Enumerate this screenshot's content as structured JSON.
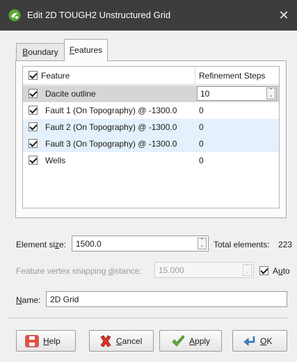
{
  "window": {
    "title": "Edit 2D TOUGH2 Unstructured Grid",
    "close_glyph": "✕"
  },
  "tabs": [
    {
      "label": "Boundary",
      "mnemonic": "B",
      "rest": "oundary"
    },
    {
      "label": "Features",
      "mnemonic": "F",
      "rest": "eatures",
      "active": true
    }
  ],
  "table": {
    "columns": [
      "Feature",
      "Refinement Steps"
    ],
    "rows": [
      {
        "name": "Dacite outline",
        "steps": "10",
        "checked": true,
        "selected": true
      },
      {
        "name": "Fault 1 (On Topography) @ -1300.0",
        "steps": "0",
        "checked": true
      },
      {
        "name": "Fault 2 (On Topography) @ -1300.0",
        "steps": "0",
        "checked": true
      },
      {
        "name": "Fault 3 (On Topography) @ -1300.0",
        "steps": "0",
        "checked": true
      },
      {
        "name": "Wells",
        "steps": "0",
        "checked": true
      }
    ]
  },
  "element_size": {
    "label_pre": "Element si",
    "label_mn": "z",
    "label_post": "e:",
    "value": "1500.0"
  },
  "total_elements": {
    "label": "Total elements:",
    "value": "223"
  },
  "snapping": {
    "label_pre": "Feature vertex snapping ",
    "label_mn": "d",
    "label_post": "istance:",
    "value": "15.000",
    "auto_pre": "A",
    "auto_mn": "u",
    "auto_post": "to",
    "auto_checked": true
  },
  "name": {
    "label_mn": "N",
    "label_post": "ame:",
    "value": "2D Grid"
  },
  "buttons": {
    "help": {
      "mn": "H",
      "rest": "elp"
    },
    "cancel": {
      "mn": "C",
      "rest": "ancel"
    },
    "apply": {
      "mn": "A",
      "rest": "pply"
    },
    "ok": {
      "mn": "O",
      "rest": "K"
    }
  },
  "colors": {
    "titlebar": "#3d3d3d",
    "selected_row": "#d6d6d6",
    "alt_row": "#e4f0fb",
    "app_icon": "#5aa832"
  },
  "icons": [
    "app-icon",
    "close-icon",
    "help-icon",
    "cancel-icon",
    "apply-icon",
    "ok-icon"
  ]
}
